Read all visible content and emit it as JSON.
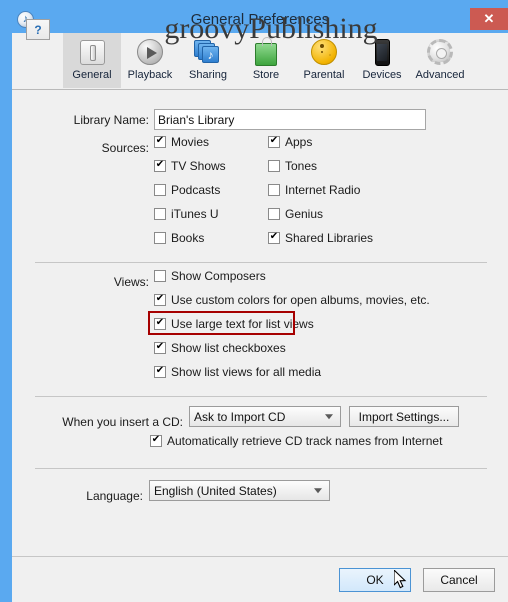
{
  "window": {
    "title": "General Preferences",
    "app_icon": "itunes-note-icon",
    "close_label": "✕"
  },
  "toolbar": {
    "tabs": [
      {
        "label": "General",
        "icon": "light-switch-icon",
        "selected": true
      },
      {
        "label": "Playback",
        "icon": "play-circle-icon",
        "selected": false
      },
      {
        "label": "Sharing",
        "icon": "stacked-squares-music-icon",
        "selected": false
      },
      {
        "label": "Store",
        "icon": "shopping-bag-icon",
        "selected": false
      },
      {
        "label": "Parental",
        "icon": "parental-figures-icon",
        "selected": false
      },
      {
        "label": "Devices",
        "icon": "iphone-icon",
        "selected": false
      },
      {
        "label": "Advanced",
        "icon": "gear-icon",
        "selected": false
      }
    ]
  },
  "library": {
    "label": "Library Name:",
    "value": "Brian's Library"
  },
  "sources": {
    "label": "Sources:",
    "left": [
      {
        "label": "Movies",
        "checked": true
      },
      {
        "label": "TV Shows",
        "checked": true
      },
      {
        "label": "Podcasts",
        "checked": false
      },
      {
        "label": "iTunes U",
        "checked": false
      },
      {
        "label": "Books",
        "checked": false
      }
    ],
    "right": [
      {
        "label": "Apps",
        "checked": true
      },
      {
        "label": "Tones",
        "checked": false
      },
      {
        "label": "Internet Radio",
        "checked": false
      },
      {
        "label": "Genius",
        "checked": false
      },
      {
        "label": "Shared Libraries",
        "checked": true
      }
    ]
  },
  "views": {
    "label": "Views:",
    "items": [
      {
        "label": "Show Composers",
        "checked": false,
        "highlighted": false
      },
      {
        "label": "Use custom colors for open albums, movies, etc.",
        "checked": true,
        "highlighted": false
      },
      {
        "label": "Use large text for list views",
        "checked": true,
        "highlighted": true
      },
      {
        "label": "Show list checkboxes",
        "checked": true,
        "highlighted": false
      },
      {
        "label": "Show list views for all media",
        "checked": true,
        "highlighted": false
      }
    ],
    "highlight_color": "#a60000"
  },
  "cd": {
    "label": "When you insert a CD:",
    "selected": "Ask to Import CD",
    "import_settings_label": "Import Settings...",
    "auto_retrieve": {
      "label": "Automatically retrieve CD track names from Internet",
      "checked": true
    }
  },
  "language": {
    "label": "Language:",
    "selected": "English (United States)"
  },
  "footer": {
    "help_label": "?",
    "watermark": "groovyPublishing",
    "ok_label": "OK",
    "cancel_label": "Cancel"
  }
}
